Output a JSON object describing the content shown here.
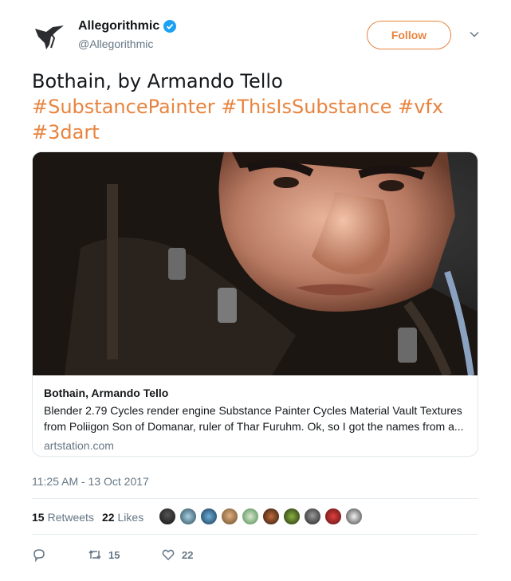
{
  "account": {
    "display_name": "Allegorithmic",
    "handle": "@Allegorithmic",
    "verified": true,
    "follow_label": "Follow"
  },
  "tweet": {
    "text_plain": "Bothain, by Armando Tello",
    "hashtags": [
      "#SubstancePainter",
      "#ThisIsSubstance",
      "#vfx",
      "#3dart"
    ]
  },
  "card": {
    "title": "Bothain, Armando Tello",
    "description": "Blender 2.79 Cycles render engine Substance Painter Cycles Material Vault Textures from Poliigon Son of Domanar, ruler of Thar Furuhm. Ok, so I got the names from a...",
    "domain": "artstation.com"
  },
  "timestamp": "11:25 AM - 13 Oct 2017",
  "stats": {
    "retweets_count": "15",
    "retweets_label": "Retweets",
    "likes_count": "22",
    "likes_label": "Likes"
  },
  "actions": {
    "reply_count": "",
    "retweet_count": "15",
    "like_count": "22"
  },
  "colors": {
    "accent": "#e8843f",
    "text": "#14171a",
    "muted": "#657786",
    "verified": "#1da1f2"
  },
  "icons": [
    "bird-logo-icon",
    "verified-badge-icon",
    "chevron-down-icon",
    "reply-icon",
    "retweet-icon",
    "heart-icon"
  ]
}
